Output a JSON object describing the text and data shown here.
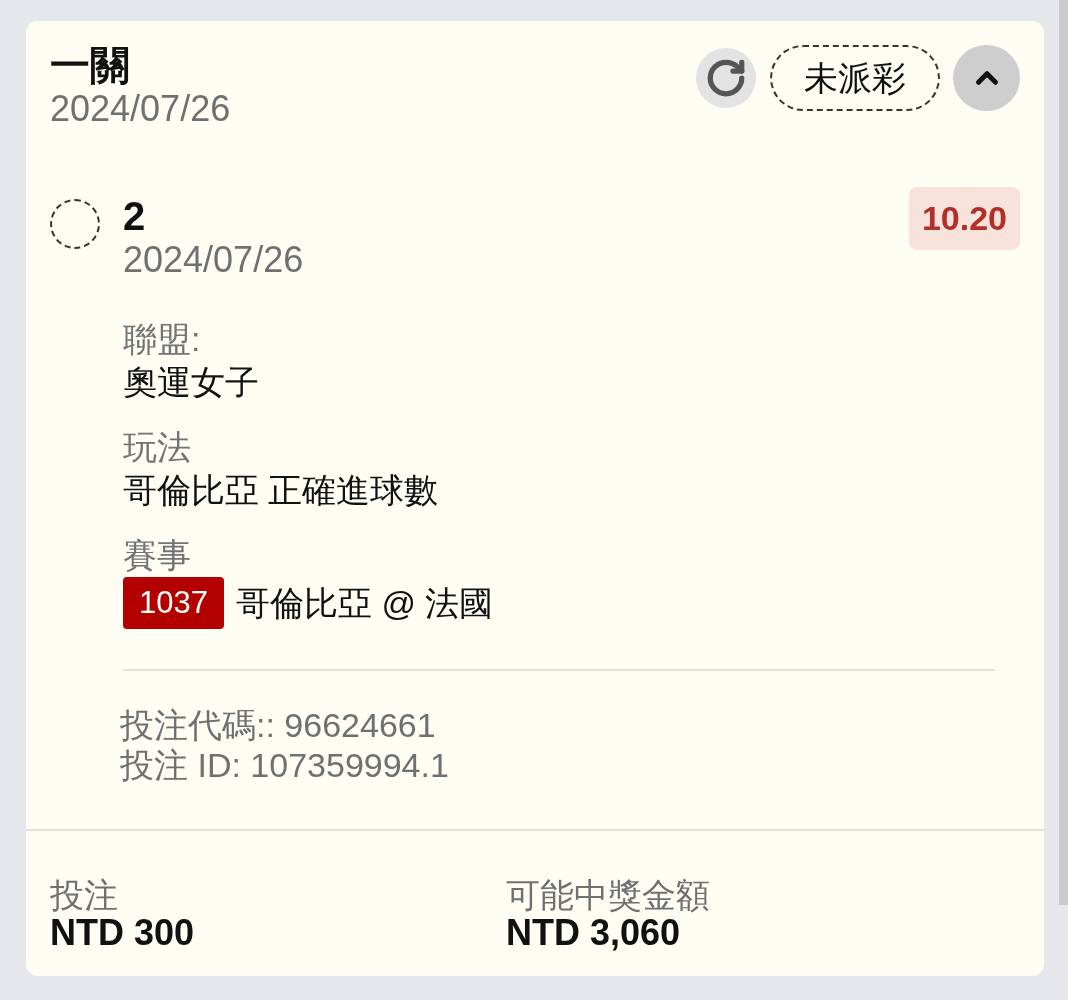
{
  "bet_card": {
    "title": "一關",
    "date": "2024/07/26",
    "status": "未派彩",
    "expanded": true,
    "selection": {
      "name": "2",
      "date": "2024/07/26",
      "odds": "10.20",
      "details": [
        {
          "kind": "text",
          "label": "聯盟:",
          "value": "奧運女子"
        },
        {
          "kind": "text",
          "label": "玩法",
          "value": "哥倫比亞 正確進球數"
        },
        {
          "kind": "match",
          "label": "賽事",
          "event_code": "1037",
          "value": "哥倫比亞 @ 法國"
        }
      ]
    },
    "bet_code": "投注代碼:: 96624661",
    "bet_id": "投注 ID: 107359994.1",
    "summary": [
      {
        "label": "投注",
        "value": "NTD 300"
      },
      {
        "label": "可能中獎金額",
        "value": "NTD 3,060"
      }
    ]
  }
}
